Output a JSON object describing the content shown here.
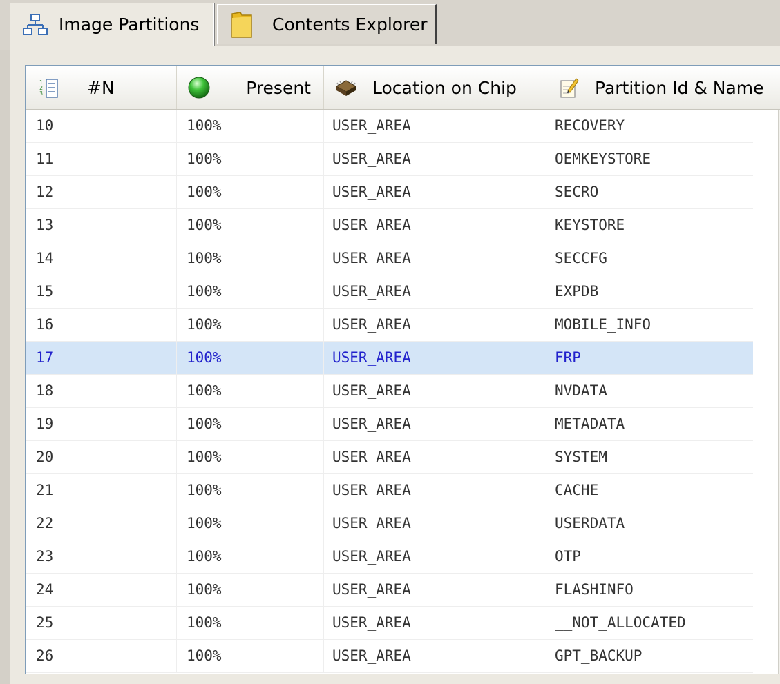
{
  "tabs": [
    {
      "label": "Image Partitions",
      "icon": "partition-tree-icon",
      "active": true
    },
    {
      "label": "Contents Explorer",
      "icon": "folder-icon",
      "active": false
    }
  ],
  "columns": [
    {
      "label": "#N",
      "icon": "list-numbers-icon"
    },
    {
      "label": "Present",
      "icon": "green-ball-icon"
    },
    {
      "label": "Location on Chip",
      "icon": "chip-icon"
    },
    {
      "label": "Partition Id & Name",
      "icon": "edit-note-icon"
    }
  ],
  "rows": [
    {
      "n": "10",
      "present": "100%",
      "location": "USER_AREA",
      "name": "RECOVERY"
    },
    {
      "n": "11",
      "present": "100%",
      "location": "USER_AREA",
      "name": "OEMKEYSTORE"
    },
    {
      "n": "12",
      "present": "100%",
      "location": "USER_AREA",
      "name": "SECRO"
    },
    {
      "n": "13",
      "present": "100%",
      "location": "USER_AREA",
      "name": "KEYSTORE"
    },
    {
      "n": "14",
      "present": "100%",
      "location": "USER_AREA",
      "name": "SECCFG"
    },
    {
      "n": "15",
      "present": "100%",
      "location": "USER_AREA",
      "name": "EXPDB"
    },
    {
      "n": "16",
      "present": "100%",
      "location": "USER_AREA",
      "name": "MOBILE_INFO"
    },
    {
      "n": "17",
      "present": "100%",
      "location": "USER_AREA",
      "name": "FRP",
      "selected": true
    },
    {
      "n": "18",
      "present": "100%",
      "location": "USER_AREA",
      "name": "NVDATA"
    },
    {
      "n": "19",
      "present": "100%",
      "location": "USER_AREA",
      "name": "METADATA"
    },
    {
      "n": "20",
      "present": "100%",
      "location": "USER_AREA",
      "name": "SYSTEM"
    },
    {
      "n": "21",
      "present": "100%",
      "location": "USER_AREA",
      "name": "CACHE"
    },
    {
      "n": "22",
      "present": "100%",
      "location": "USER_AREA",
      "name": "USERDATA"
    },
    {
      "n": "23",
      "present": "100%",
      "location": "USER_AREA",
      "name": "OTP"
    },
    {
      "n": "24",
      "present": "100%",
      "location": "USER_AREA",
      "name": "FLASHINFO"
    },
    {
      "n": "25",
      "present": "100%",
      "location": "USER_AREA",
      "name": "__NOT_ALLOCATED"
    },
    {
      "n": "26",
      "present": "100%",
      "location": "USER_AREA",
      "name": "GPT_BACKUP"
    }
  ],
  "colors": {
    "selected_row_bg": "#d4e5f7",
    "selected_text": "#2222cc",
    "grid_border": "#7f9db9"
  },
  "scrollbar": {
    "up_icon": "scroll-up-arrow-icon",
    "down_icon": "scroll-down-arrow-icon"
  }
}
